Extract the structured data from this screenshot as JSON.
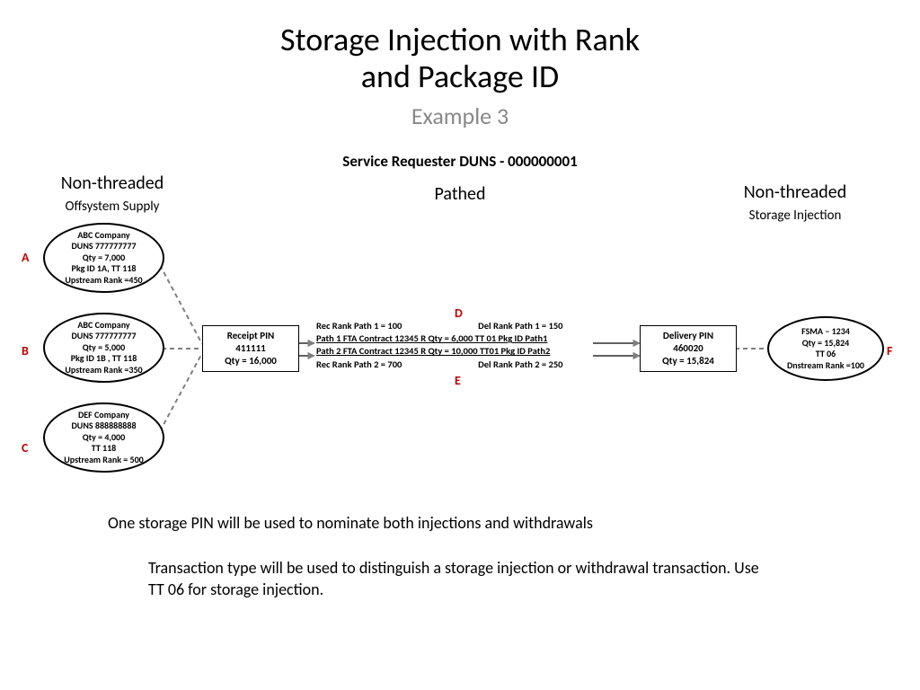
{
  "title_line1": "Storage Injection with Rank",
  "title_line2": "and Package ID",
  "subtitle": "Example 3",
  "service_requester": "Service Requester DUNS - 000000001",
  "pathed": "Pathed",
  "left_col": {
    "label": "Non-threaded",
    "sublabel": "Offsystem Supply"
  },
  "right_col": {
    "label": "Non-threaded",
    "sublabel": "Storage Injection"
  },
  "letters": {
    "A": "A",
    "B": "B",
    "C": "C",
    "D": "D",
    "E": "E",
    "F": "F"
  },
  "nodes": {
    "A": {
      "l1": "ABC Company",
      "l2": "DUNS 777777777",
      "l3": "Qty = 7,000",
      "l4": "Pkg  ID 1A, TT 118",
      "l5": "Upstream Rank =450"
    },
    "B": {
      "l1": "ABC Company",
      "l2": "DUNS 777777777",
      "l3": "Qty = 5,000",
      "l4": "Pkg  ID 1B , TT 118",
      "l5": "Upstream Rank =350"
    },
    "C": {
      "l1": "DEF Company",
      "l2": "DUNS 888888888",
      "l3": "Qty = 4,000",
      "l4": "TT 118",
      "l5": "Upstream Rank = 500"
    },
    "receipt": {
      "l1": "Receipt PIN",
      "l2": "411111",
      "l3": "Qty = 16,000"
    },
    "delivery": {
      "l1": "Delivery PIN",
      "l2": "460020",
      "l3": "Qty = 15,824"
    },
    "F": {
      "l1": "FSMA – 1234",
      "l2": "Qty = 15,824",
      "l3": "TT 06",
      "l4": "Dnstream Rank =100"
    }
  },
  "paths": {
    "rec1": "Rec Rank Path 1 = 100",
    "del1": "Del Rank Path 1 = 150",
    "p1": "Path 1  FTA Contract  12345  R Qty = 6,000  TT 01   Pkg ID Path1",
    "p2": "Path 2  FTA Contract 12345 R Qty =  10,000  TT01  Pkg ID Path2",
    "rec2": "Rec Rank Path 2 = 700",
    "del2": "Del Rank Path 2 = 250"
  },
  "note1": "One storage PIN will be used to nominate both injections and withdrawals",
  "note2": "Transaction type will be used to distinguish a storage injection or withdrawal transaction.  Use TT 06 for storage injection."
}
